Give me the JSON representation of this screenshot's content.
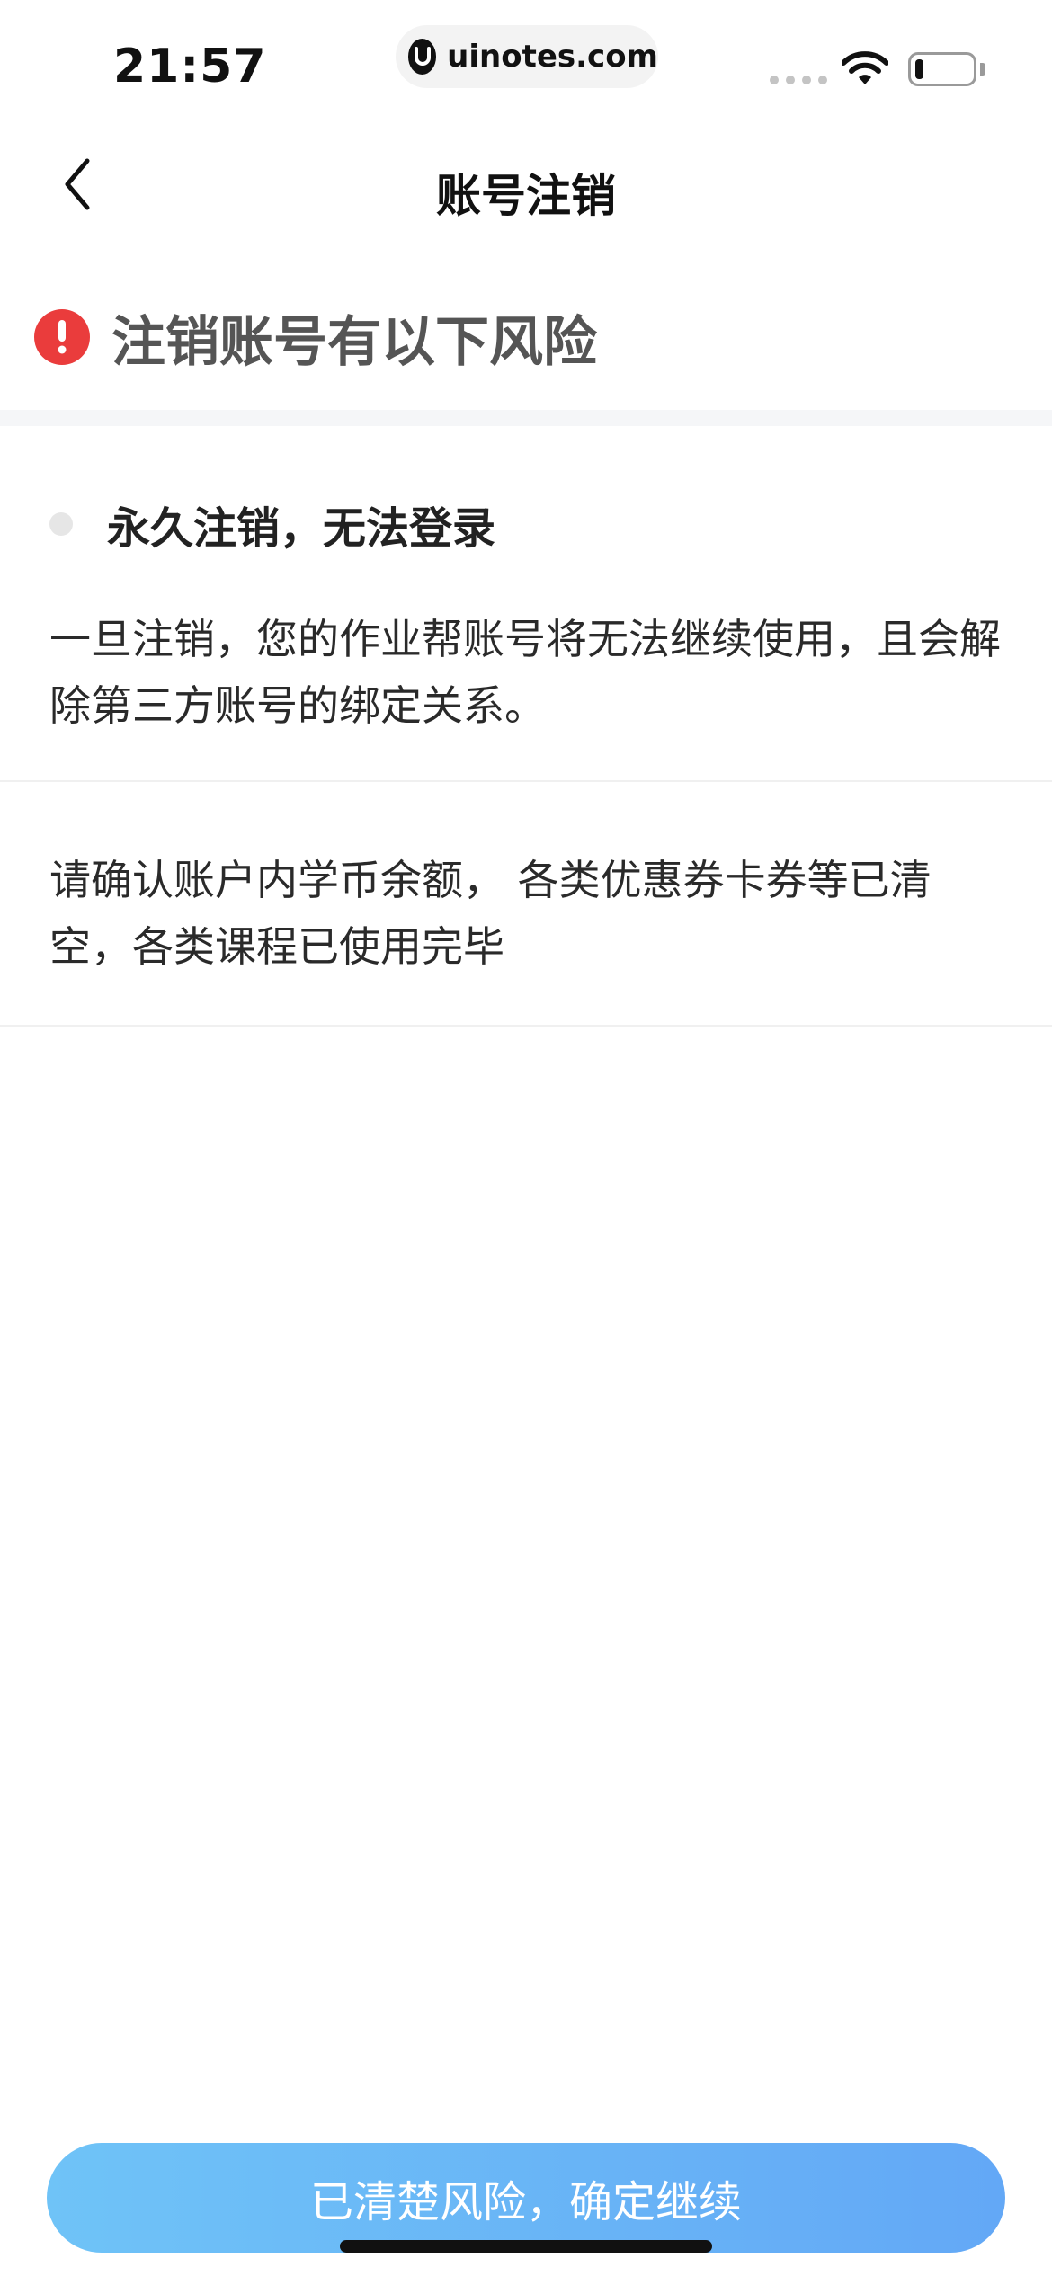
{
  "status_bar": {
    "time": "21:57",
    "url": "uinotes.com",
    "battery_level": 0.15
  },
  "nav": {
    "title": "账号注销",
    "back_icon": "chevron-left-icon"
  },
  "warning": {
    "icon": "exclamation-circle-icon",
    "icon_color": "#ea3c3c",
    "title": "注销账号有以下风险"
  },
  "risks": [
    {
      "heading": "永久注销，无法登录",
      "description": "一旦注销，您的作业帮账号将无法继续使用，且会解除第三方账号的绑定关系。"
    },
    {
      "description": "请确认账户内学币余额， 各类优惠券卡券等已清空，各类课程已使用完毕"
    }
  ],
  "footer": {
    "confirm_label": "已清楚风险，确定继续",
    "button_gradient": [
      "#6fc3f7",
      "#63a8f6"
    ]
  }
}
